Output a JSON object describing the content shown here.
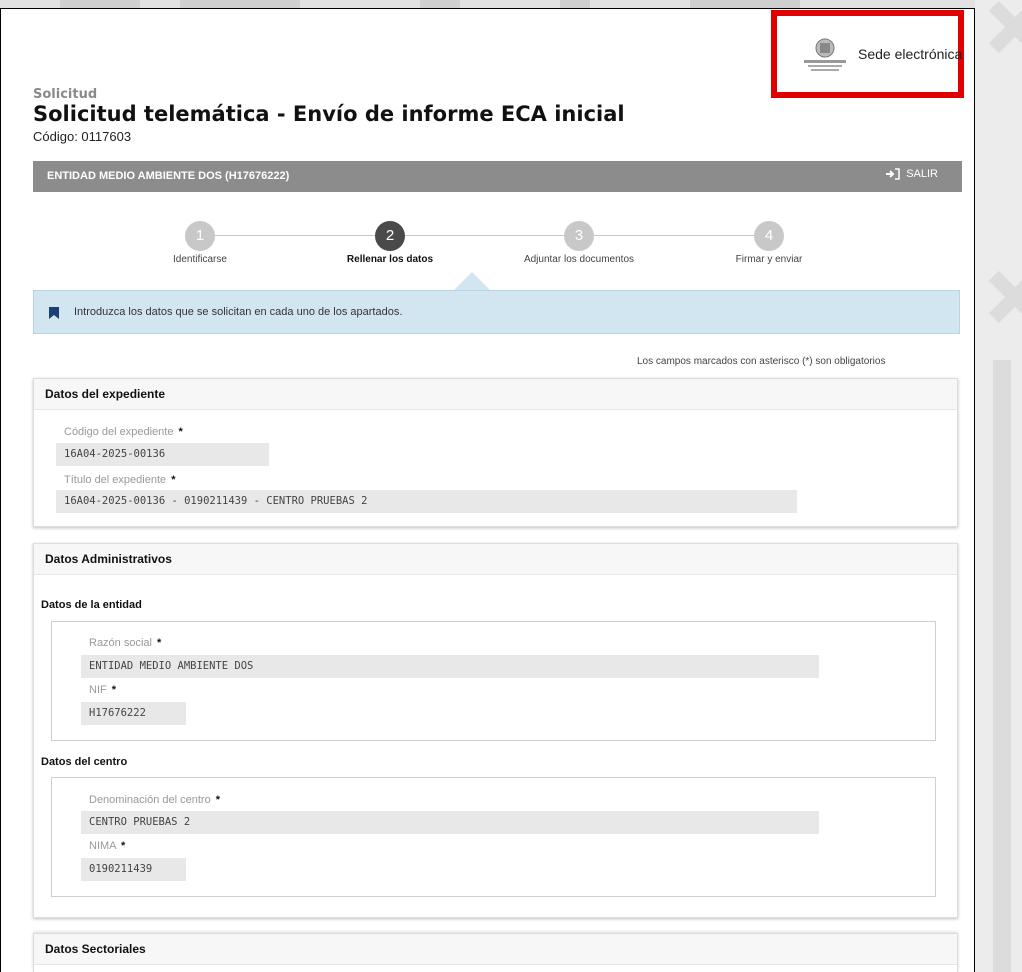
{
  "header": {
    "logo_text": "Sede electrónica",
    "logo_caption": "EUSKO JAURLARITZA GOBIERNO VASCO",
    "kicker": "Solicitud",
    "title": "Solicitud telemática - Envío de informe ECA inicial",
    "code": "Código: 0117603"
  },
  "entity_bar": {
    "name": "ENTIDAD MEDIO AMBIENTE DOS (H17676222)",
    "logout_label": "SALIR"
  },
  "steps": [
    {
      "number": "1",
      "label": "Identificarse",
      "active": false
    },
    {
      "number": "2",
      "label": "Rellenar los datos",
      "active": true
    },
    {
      "number": "3",
      "label": "Adjuntar los documentos",
      "active": false
    },
    {
      "number": "4",
      "label": "Firmar y enviar",
      "active": false
    }
  ],
  "info": {
    "text": "Introduzca los datos que se solicitan en cada uno de los apartados."
  },
  "required_note": "Los campos marcados con asterisco (*) son obligatorios",
  "expediente": {
    "title": "Datos del expediente",
    "codigo_label": "Código del expediente",
    "codigo_value": "16A04-2025-00136",
    "titulo_label": "Título del expediente",
    "titulo_value": "16A04-2025-00136 - 0190211439 - CENTRO PRUEBAS 2"
  },
  "administrativos": {
    "title": "Datos Administrativos",
    "entidad_title": "Datos de la entidad",
    "razon_label": "Razón social",
    "razon_value": "ENTIDAD MEDIO AMBIENTE DOS",
    "nif_label": "NIF",
    "nif_value": "H17676222",
    "centro_title": "Datos del centro",
    "denominacion_label": "Denominación del centro",
    "denominacion_value": "CENTRO PRUEBAS 2",
    "nima_label": "NIMA",
    "nima_value": "0190211439"
  },
  "sectoriales": {
    "title": "Datos Sectoriales"
  },
  "required_marker": "*"
}
